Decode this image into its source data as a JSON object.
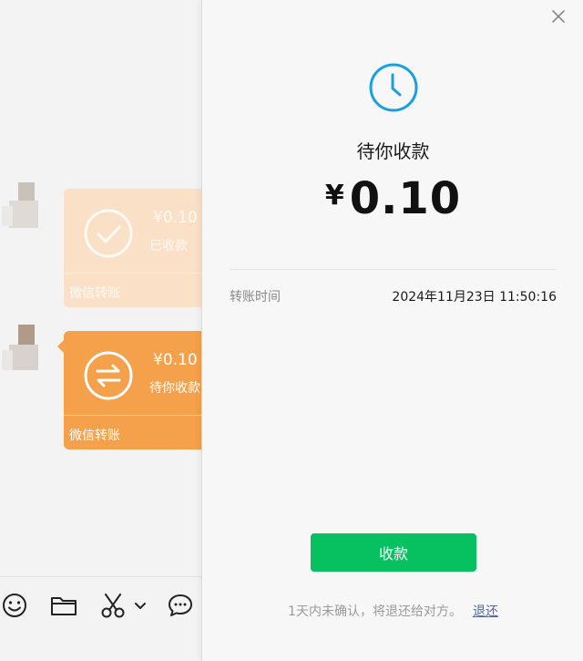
{
  "chat": {
    "bubbles": [
      {
        "amount": "¥0.10",
        "status": "已收款",
        "footer": "微信转账"
      },
      {
        "amount": "¥0.10",
        "status": "待你收款",
        "footer": "微信转账"
      }
    ],
    "toolbar": [
      "emoji-icon",
      "folder-icon",
      "scissors-icon",
      "chevron-down-icon",
      "chat-bubble-icon"
    ]
  },
  "dialog": {
    "title": "待你收款",
    "currency": "¥",
    "amount": "0.10",
    "transfer_time_label": "转账时间",
    "transfer_time_value": "2024年11月23日 11:50:16",
    "accept_button": "收款",
    "hint_text": "1天内未确认，将退还给对方。",
    "return_link": "退还"
  },
  "colors": {
    "accent_green": "#07c160",
    "clock_blue": "#1aa0e0",
    "transfer_orange": "#f5a04a",
    "transfer_orange_faded": "#fbe0c4",
    "link_blue": "#576b95"
  }
}
